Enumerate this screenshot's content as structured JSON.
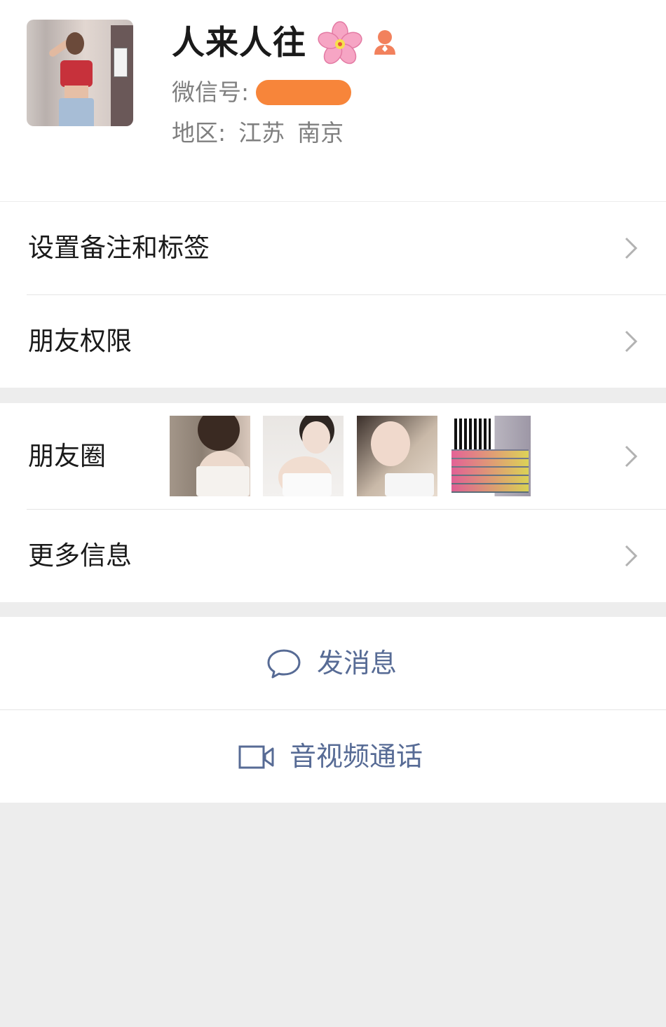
{
  "profile": {
    "name": "人来人往",
    "wechat_id_label": "微信号:",
    "region_label": "地区:",
    "region_province": "江苏",
    "region_city": "南京",
    "name_emoji_icon": "cherry-blossom-icon",
    "gender_icon": "female-icon"
  },
  "settings": {
    "remark_tags": "设置备注和标签",
    "friend_permissions": "朋友权限"
  },
  "moments": {
    "label": "朋友圈"
  },
  "more_info": {
    "label": "更多信息"
  },
  "actions": {
    "send_message": "发消息",
    "video_call": "音视频通话"
  },
  "colors": {
    "accent": "#576b95",
    "background": "#ededed",
    "redaction": "#f7853a"
  }
}
